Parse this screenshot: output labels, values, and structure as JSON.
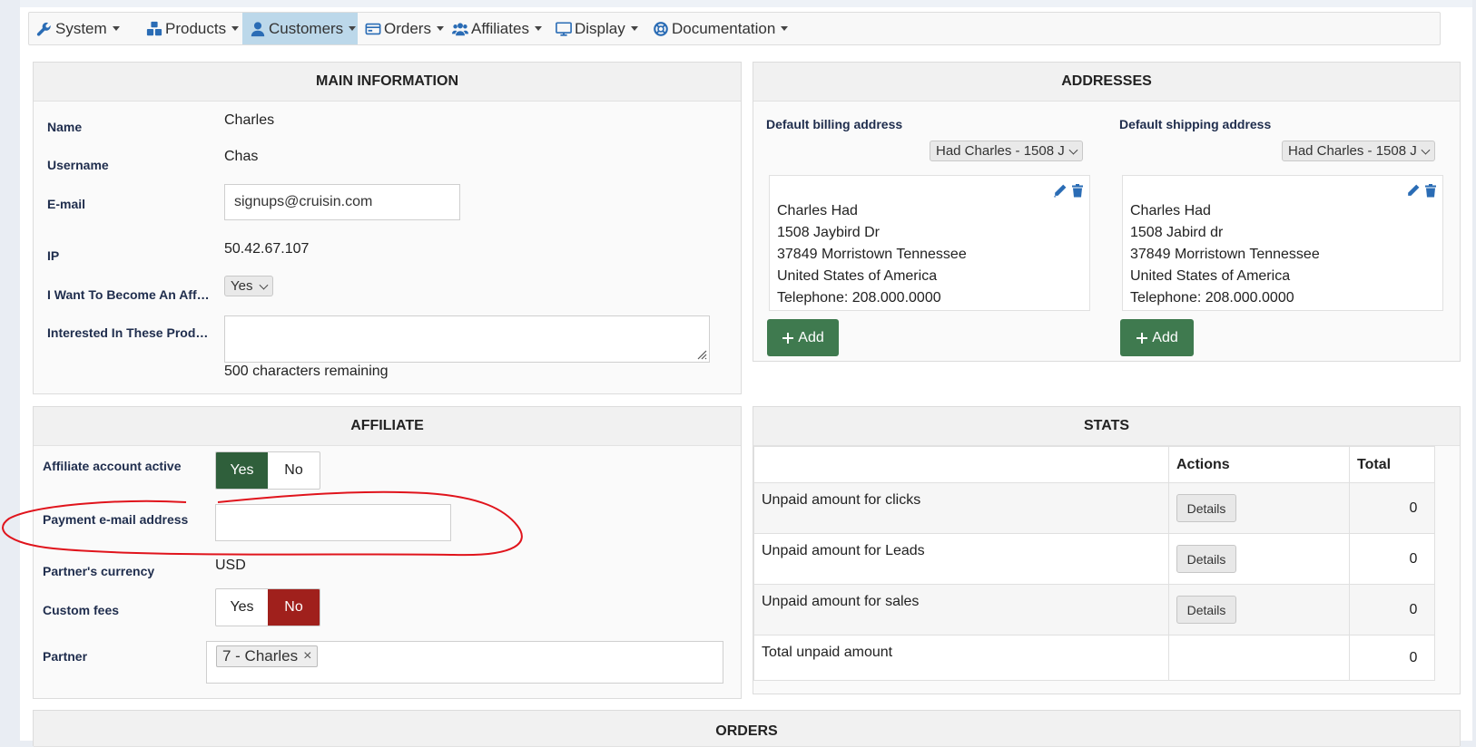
{
  "nav": {
    "items": [
      {
        "label": "System",
        "icon": "wrench-icon"
      },
      {
        "label": "Products",
        "icon": "cubes-icon"
      },
      {
        "label": "Customers",
        "icon": "user-icon"
      },
      {
        "label": "Orders",
        "icon": "credit-card-icon"
      },
      {
        "label": "Affiliates",
        "icon": "users-icon"
      },
      {
        "label": "Display",
        "icon": "desktop-icon"
      },
      {
        "label": "Documentation",
        "icon": "life-ring-icon"
      }
    ],
    "active": "Customers"
  },
  "main_info": {
    "title": "MAIN INFORMATION",
    "name_label": "Name",
    "name_value": "Charles",
    "username_label": "Username",
    "username_value": "Chas",
    "email_label": "E-mail",
    "email_value": "signups@cruisin.com",
    "ip_label": "IP",
    "ip_value": "50.42.67.107",
    "affiliate_label": "I Want To Become An Affil...",
    "affiliate_value": "Yes",
    "interested_label": "Interested In These Produ...",
    "chars_remaining": "500 characters remaining"
  },
  "addresses": {
    "title": "ADDRESSES",
    "billing": {
      "label": "Default billing address",
      "select_value": "Had Charles - 1508 J",
      "lines": [
        "Charles Had",
        "1508 Jaybird Dr",
        "37849 Morristown Tennessee",
        "United States of America",
        "Telephone: 208.000.0000"
      ],
      "add_label": "Add"
    },
    "shipping": {
      "label": "Default shipping address",
      "select_value": "Had Charles - 1508 J",
      "lines": [
        "Charles Had",
        "1508 Jabird dr",
        "37849 Morristown Tennessee",
        "United States of America",
        "Telephone: 208.000.0000"
      ],
      "add_label": "Add"
    }
  },
  "affiliate": {
    "title": "AFFILIATE",
    "active_label": "Affiliate account active",
    "yes": "Yes",
    "no": "No",
    "payment_email_label": "Payment e-mail address",
    "payment_email_value": "",
    "currency_label": "Partner's currency",
    "currency_value": "USD",
    "custom_fees_label": "Custom fees",
    "partner_label": "Partner",
    "partner_tag": "7 - Charles",
    "tag_remove": "×"
  },
  "stats": {
    "title": "STATS",
    "col_actions": "Actions",
    "col_total": "Total",
    "rows": [
      {
        "label": "Unpaid amount for clicks",
        "action": "Details",
        "total": "0"
      },
      {
        "label": "Unpaid amount for Leads",
        "action": "Details",
        "total": "0"
      },
      {
        "label": "Unpaid amount for sales",
        "action": "Details",
        "total": "0"
      },
      {
        "label": "Total unpaid amount",
        "action": "",
        "total": "0"
      }
    ]
  },
  "orders": {
    "title": "ORDERS"
  },
  "colors": {
    "active_nav": "#bcd8ea",
    "add_button": "#3f7a4f",
    "toggle_yes_active": "#2f5f3b",
    "toggle_no_active": "#a0201c",
    "annotation": "#e0141c"
  }
}
